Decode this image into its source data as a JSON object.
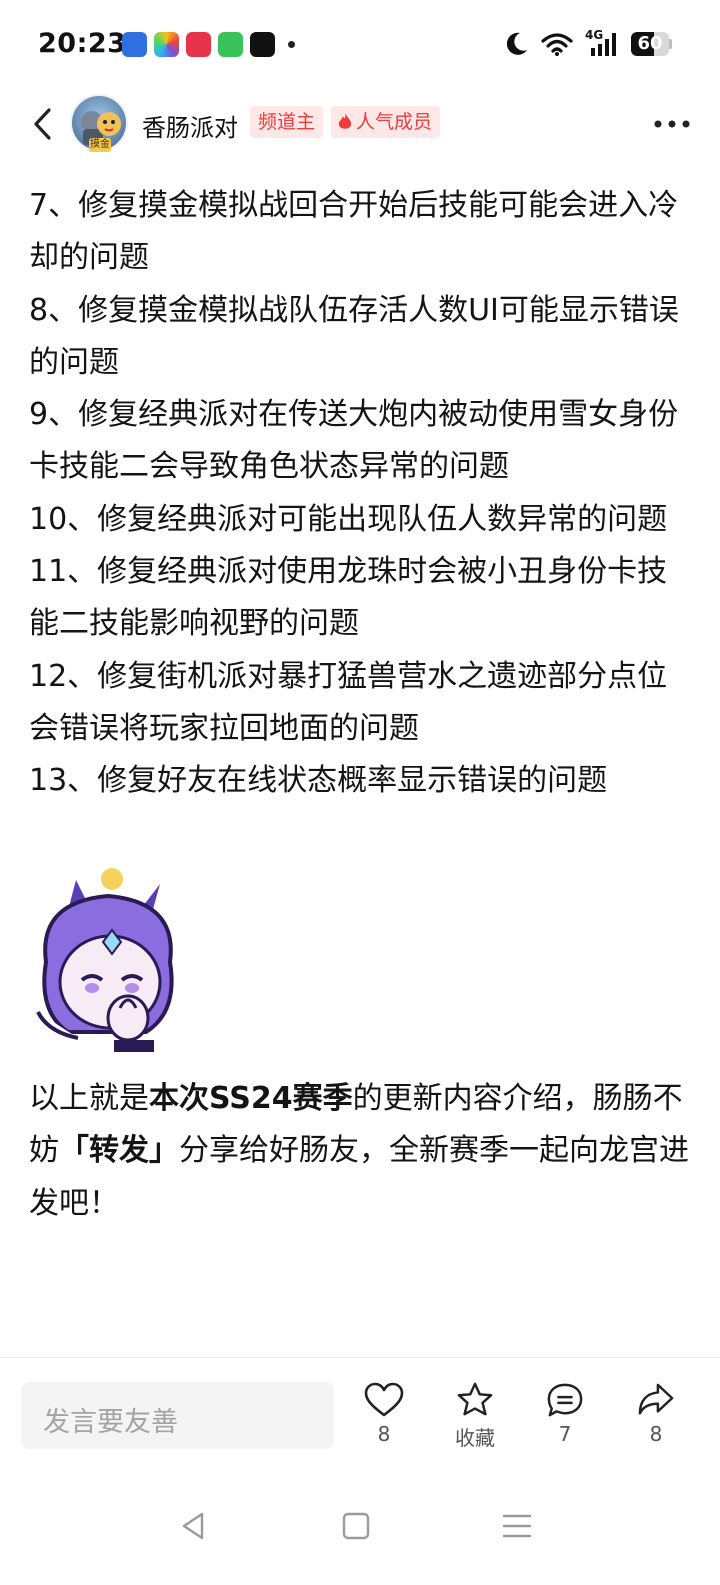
{
  "status_bar": {
    "time": "20:23",
    "network": "4G",
    "battery": "60",
    "battery_level": 0.6
  },
  "header": {
    "channel_name": "香肠派对",
    "avatar_badge": "摸金",
    "tag_owner": "频道主",
    "tag_popular": "人气成员"
  },
  "article": {
    "lines": [
      "7、修复摸金模拟战回合开始后技能可能会进入冷却的问题",
      "8、修复摸金模拟战队伍存活人数UI可能显示错误的问题",
      "9、修复经典派对在传送大炮内被动使用雪女身份卡技能二会导致角色状态异常的问题",
      "10、修复经典派对可能出现队伍人数异常的问题",
      "11、修复经典派对使用龙珠时会被小丑身份卡技能二技能影响视野的问题",
      "12、修复街机派对暴打猛兽营水之遗迹部分点位会错误将玩家拉回地面的问题",
      "13、修复好友在线状态概率显示错误的问题"
    ],
    "outro": {
      "part1": "以上就是",
      "bold1": "本次SS24赛季",
      "part2": "的更新内容介绍，肠肠不妨",
      "bold2": "「转发」",
      "part3": "分享给好肠友，全新赛季一起向龙宫进发吧！"
    }
  },
  "bottom_bar": {
    "comment_placeholder": "发言要友善",
    "like_count": "8",
    "favorite_label": "收藏",
    "comment_count": "7",
    "share_count": "8"
  }
}
